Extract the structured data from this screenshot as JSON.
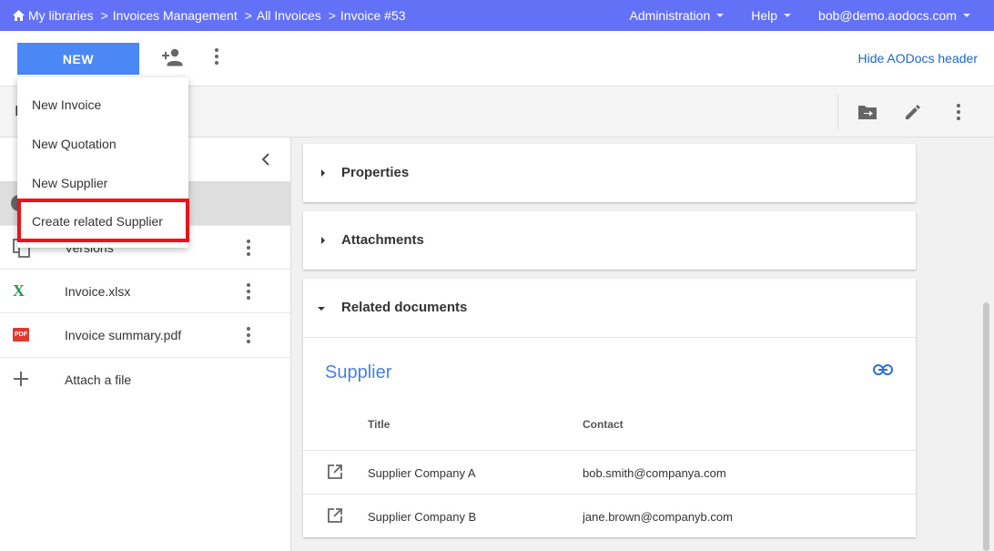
{
  "breadcrumb": {
    "items": [
      "My libraries",
      "Invoices Management",
      "All Invoices",
      "Invoice #53"
    ],
    "separator": ">"
  },
  "topnav": {
    "administration": "Administration",
    "help": "Help",
    "user": "bob@demo.aodocs.com"
  },
  "toolbar": {
    "new_label": "NEW",
    "hide_header_label": "Hide AODocs header"
  },
  "bar2": {
    "doc_initial": "I"
  },
  "new_menu": {
    "items": [
      "New Invoice",
      "New Quotation",
      "New Supplier",
      "Create related Supplier"
    ],
    "highlighted_index": 3
  },
  "left_panel": {
    "rows": [
      {
        "icon": "copy-icon",
        "label": "Versions"
      },
      {
        "icon": "excel-icon",
        "icon_text": "X",
        "label": "Invoice.xlsx"
      },
      {
        "icon": "pdf-icon",
        "icon_text": "PDF",
        "label": "Invoice summary.pdf"
      },
      {
        "icon": "plus-icon",
        "label": "Attach a file"
      }
    ]
  },
  "sections": {
    "properties": "Properties",
    "attachments": "Attachments",
    "related_documents": "Related documents"
  },
  "related": {
    "title": "Supplier",
    "columns": {
      "title": "Title",
      "contact": "Contact"
    },
    "rows": [
      {
        "title": "Supplier Company A",
        "contact": "bob.smith@companya.com"
      },
      {
        "title": "Supplier Company B",
        "contact": "jane.brown@companyb.com"
      }
    ]
  },
  "colors": {
    "topbar": "#6271f5",
    "primary_button": "#4c87f6",
    "link": "#1f66c8",
    "supplier_title": "#4a7fe0",
    "highlight_outline": "#e8141a",
    "excel_green": "#1e9e4a",
    "pdf_red": "#e03a2f"
  }
}
